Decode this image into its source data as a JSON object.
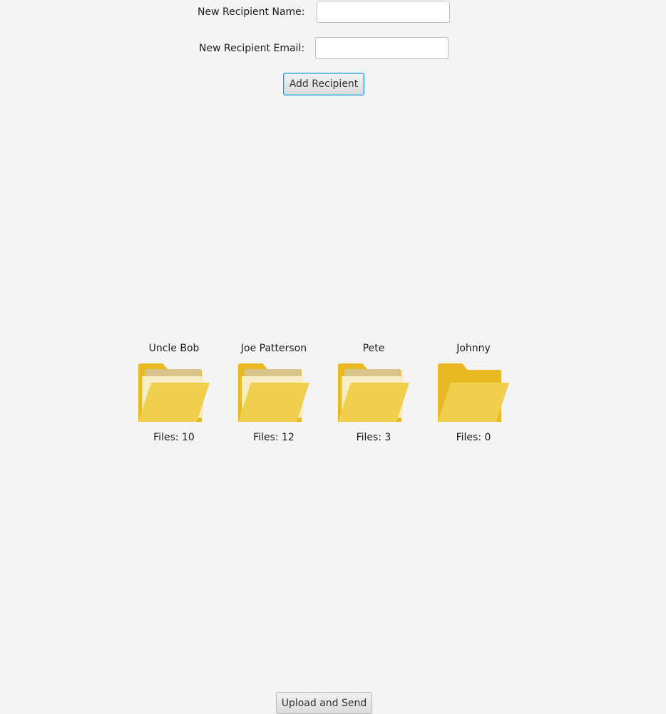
{
  "form": {
    "name_label": "New Recipient Name:",
    "name_value": "",
    "email_label": "New Recipient Email:",
    "email_value": "",
    "add_button": "Add Recipient"
  },
  "recipients": [
    {
      "name": "Uncle Bob",
      "files": "Files: 10",
      "icon": "open-folder-with-papers"
    },
    {
      "name": "Joe Patterson",
      "files": "Files: 12",
      "icon": "open-folder-with-papers"
    },
    {
      "name": "Pete",
      "files": "Files: 3",
      "icon": "open-folder-with-papers"
    },
    {
      "name": "Johnny",
      "files": "Files: 0",
      "icon": "empty-open-folder"
    }
  ],
  "footer": {
    "upload_button": "Upload and Send"
  },
  "colors": {
    "background": "#f4f4f4",
    "folder_back": "#e8b923",
    "folder_front": "#f0cf4c",
    "paper_back": "#d6c48a",
    "paper_front": "#f7ecc4",
    "focus_border": "#2a9fd6"
  }
}
